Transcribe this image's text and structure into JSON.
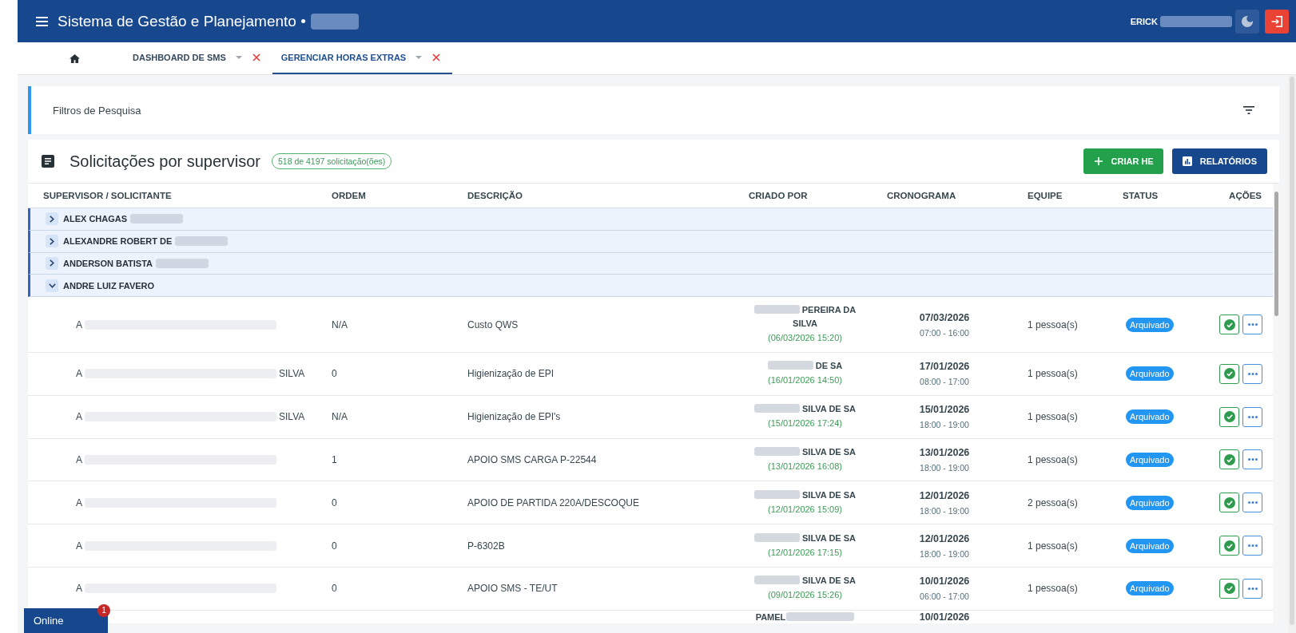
{
  "app_bar": {
    "title": "Sistema de Gestão e Planejamento •",
    "user": "ERICK"
  },
  "tabs": [
    {
      "label": "DASHBOARD DE SMS",
      "selected": false
    },
    {
      "label": "GERENCIAR HORAS EXTRAS",
      "selected": true
    }
  ],
  "filters": {
    "title": "Filtros de Pesquisa"
  },
  "panel": {
    "title": "Solicitações por supervisor",
    "count": "518 de 4197 solicitação(ões)",
    "buttons": [
      {
        "label": "CRIAR HE",
        "kind": "create"
      },
      {
        "label": "RELATÓRIOS",
        "kind": "reports"
      }
    ]
  },
  "table": {
    "columns": [
      "SUPERVISOR / SOLICITANTE",
      "ORDEM",
      "DESCRIÇÃO",
      "CRIADO POR",
      "CRONOGRAMA",
      "EQUIPE",
      "STATUS",
      "AÇÕES"
    ],
    "groups": [
      {
        "name": "ALEX CHAGAS",
        "redacted": true,
        "expanded": false
      },
      {
        "name": "ALEXANDRE ROBERT DE",
        "redacted": true,
        "expanded": false
      },
      {
        "name": "ANDERSON BATISTA",
        "redacted": true,
        "expanded": false
      },
      {
        "name": "ANDRE LUIZ FAVERO",
        "redacted": false,
        "expanded": true,
        "rows": [
          {
            "kind": "full",
            "requester": "A",
            "order": "N/A",
            "description": "Custo QWS",
            "created_by": "PEREIRA DA SILVA",
            "created_at": "(06/03/2026 15:20)",
            "date": "07/03/2026",
            "time": "07:00 - 16:00",
            "team": "1 pessoa(s)",
            "status": "Arquivado"
          },
          {
            "kind": "full",
            "requester": "A",
            "requester_end": "SILVA",
            "order": "0",
            "description": "Higienização de EPI",
            "created_by": "DE SA",
            "created_at": "(16/01/2026 14:50)",
            "date": "17/01/2026",
            "time": "08:00 - 17:00",
            "team": "1 pessoa(s)",
            "status": "Arquivado"
          },
          {
            "kind": "full",
            "requester": "A",
            "requester_end": "SILVA",
            "order": "N/A",
            "description": "Higienização de EPI's",
            "created_by": "SILVA DE SA",
            "created_at": "(15/01/2026 17:24)",
            "date": "15/01/2026",
            "time": "18:00 - 19:00",
            "team": "1 pessoa(s)",
            "status": "Arquivado"
          },
          {
            "kind": "full",
            "requester": "A",
            "order": "1",
            "description": "APOIO SMS CARGA P-22544",
            "created_by": "SILVA DE SA",
            "created_at": "(13/01/2026 16:08)",
            "date": "13/01/2026",
            "time": "18:00 - 19:00",
            "team": "1 pessoa(s)",
            "status": "Arquivado"
          },
          {
            "kind": "full",
            "requester": "A",
            "order": "0",
            "description": "APOIO DE PARTIDA 220A/DESCOQUE",
            "created_by": "SILVA DE SA",
            "created_at": "(12/01/2026 15:09)",
            "date": "12/01/2026",
            "time": "18:00 - 19:00",
            "team": "2 pessoa(s)",
            "status": "Arquivado"
          },
          {
            "kind": "full",
            "requester": "A",
            "order": "0",
            "description": "P-6302B",
            "created_by": "SILVA DE SA",
            "created_at": "(12/01/2026 17:15)",
            "date": "12/01/2026",
            "time": "18:00 - 19:00",
            "team": "1 pessoa(s)",
            "status": "Arquivado"
          },
          {
            "kind": "full",
            "requester": "A",
            "order": "0",
            "description": "APOIO SMS - TE/UT",
            "created_by": "SILVA DE SA",
            "created_at": "(09/01/2026 15:26)",
            "date": "10/01/2026",
            "time": "06:00 - 17:00",
            "team": "1 pessoa(s)",
            "status": "Arquivado"
          },
          {
            "kind": "partial",
            "created_by": "PAMEL",
            "date": "10/01/2026"
          }
        ]
      }
    ]
  },
  "connection": {
    "label": "Online",
    "badge": "1"
  }
}
